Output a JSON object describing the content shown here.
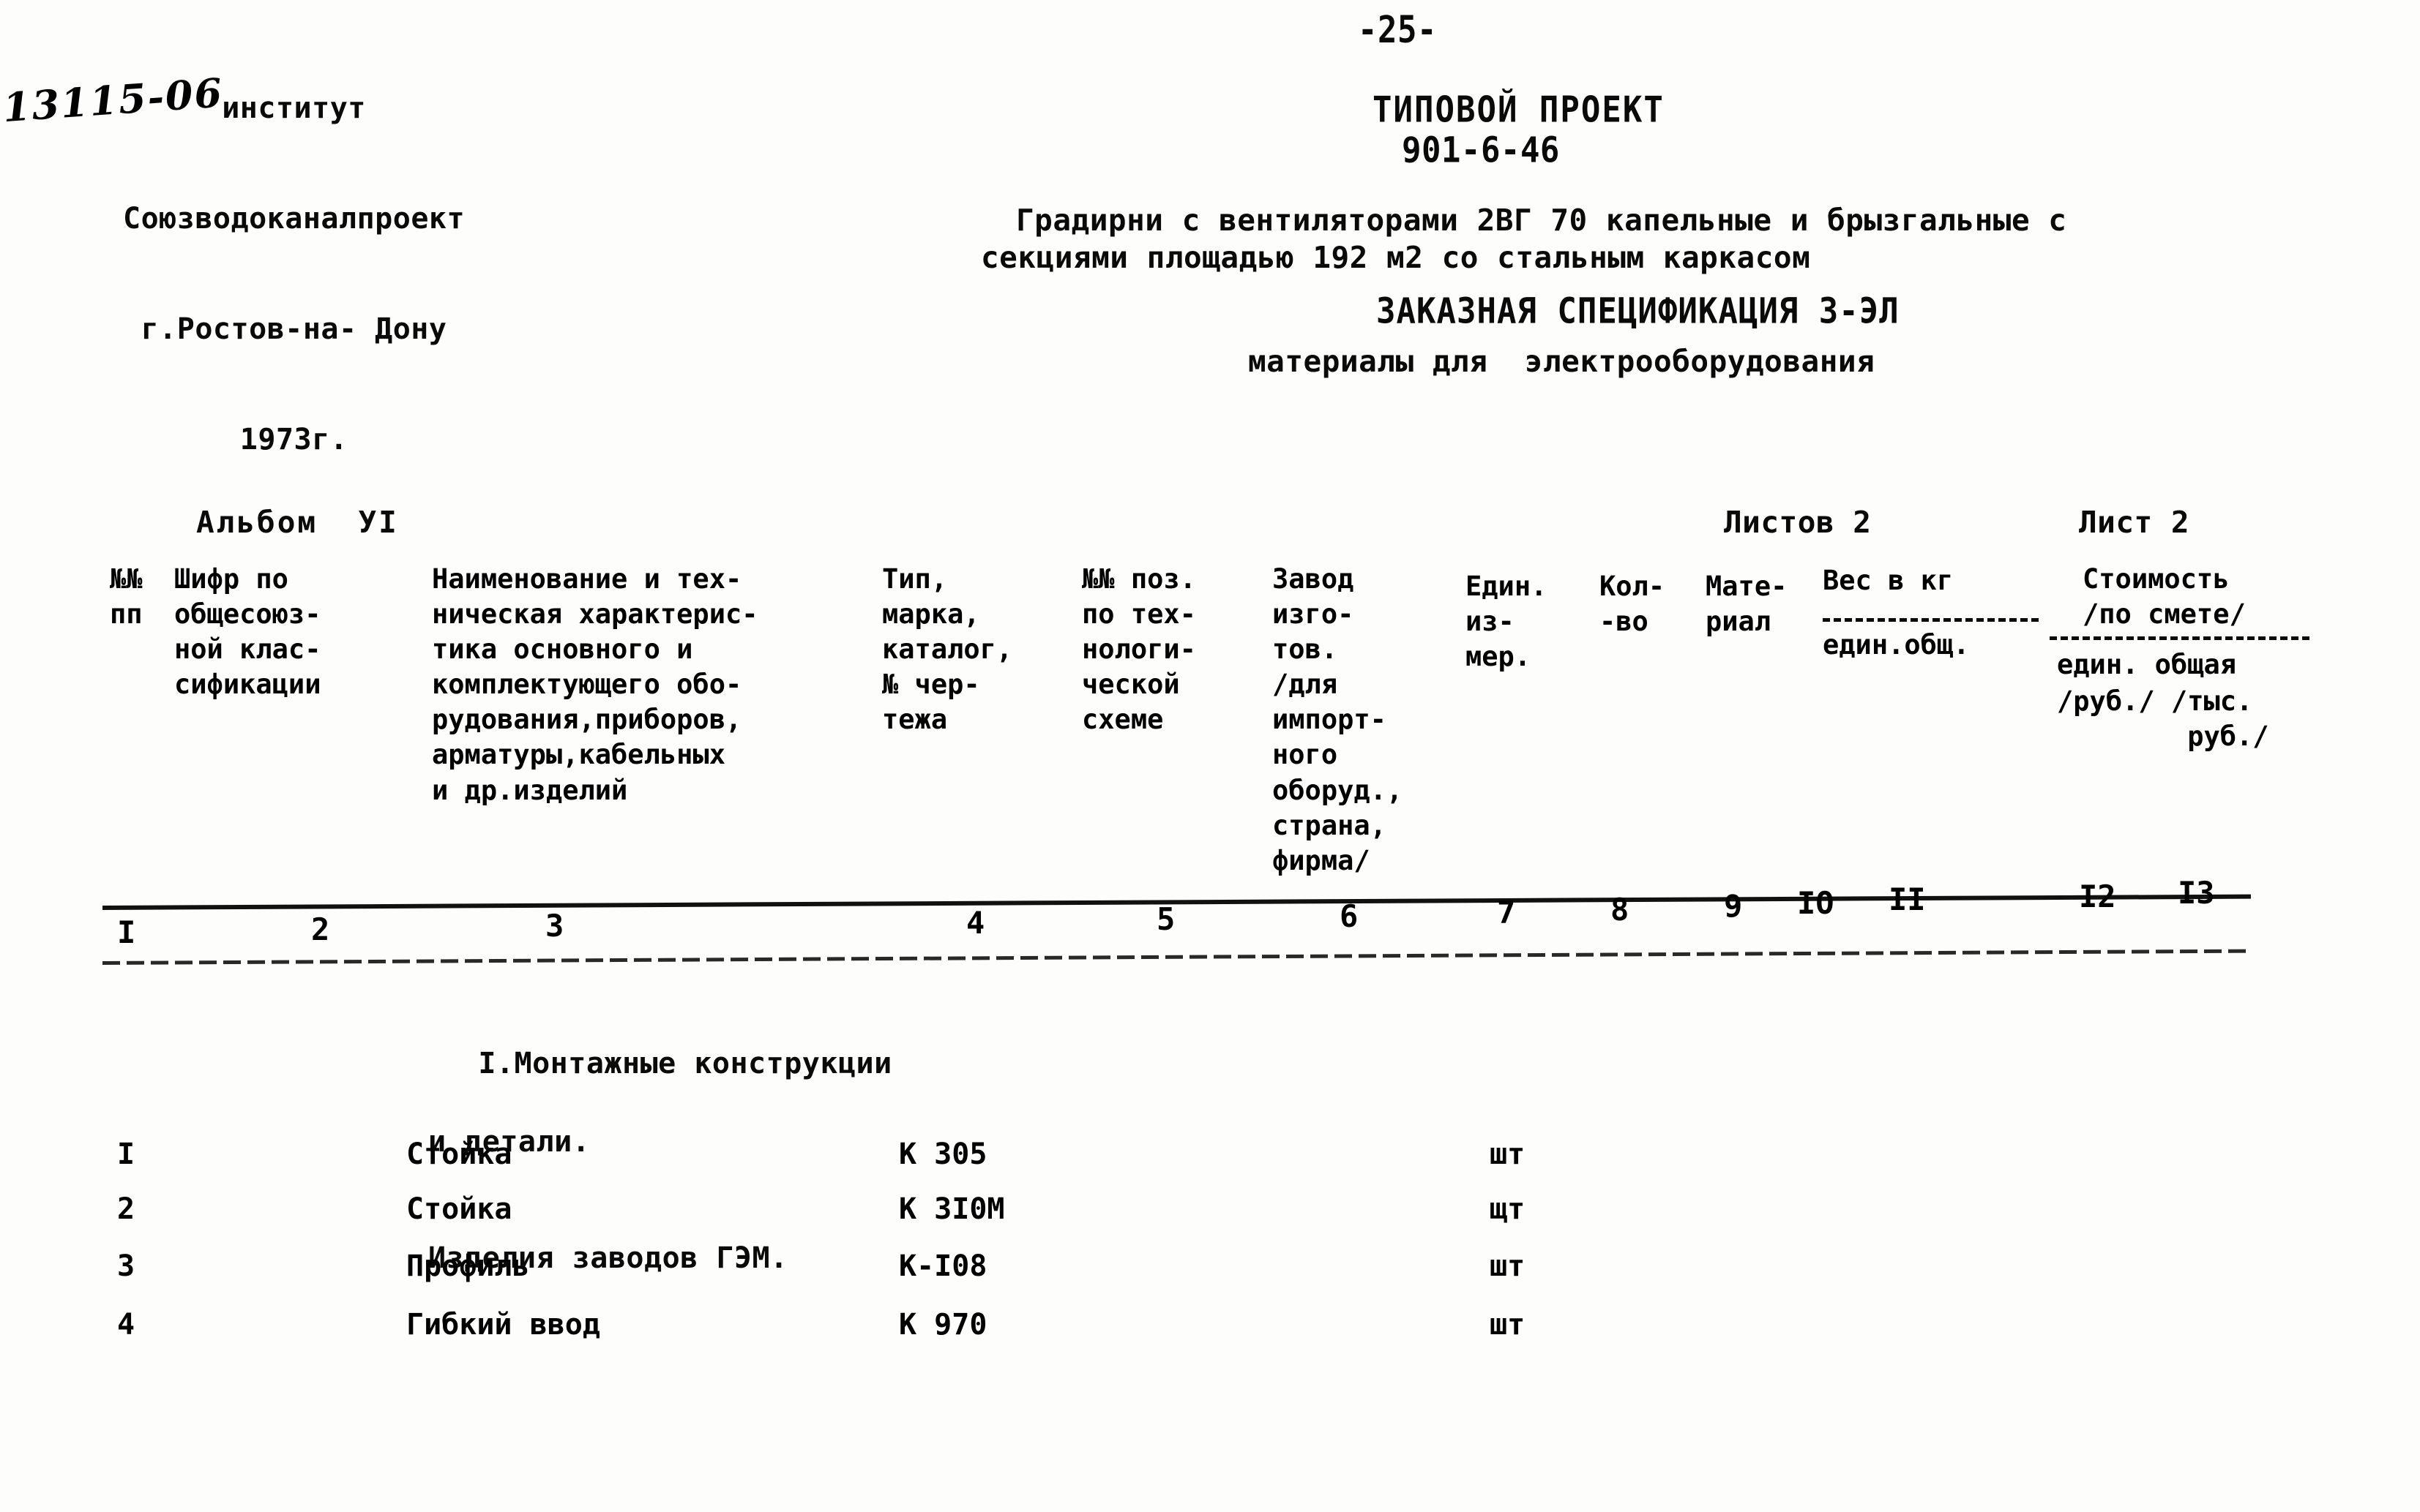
{
  "header": {
    "institute": [
      "институт",
      "Союзводоканалпроект",
      "г.Ростов-на- Дону",
      "1973г."
    ],
    "page_number": "-25-",
    "drawing_code": "13115-06"
  },
  "title": {
    "project_label": "ТИПОВОЙ ПРОЕКТ",
    "project_code": "901-6-46",
    "description_line1": "Градирни с вентиляторами 2ВГ 70 капельные и брызгальные с",
    "description_line2": "секциями площадью 192 м2 со стальным каркасом",
    "specification": "ЗАКАЗНАЯ СПЕЦИФИКАЦИЯ З-ЭЛ",
    "subtitle": "материалы для  электрооборудования"
  },
  "document_info": {
    "album": "Альбом  УI",
    "sheets_total": "Листов 2",
    "sheet_number": "Лист 2"
  },
  "table": {
    "headers": {
      "col1": "№№\nпп",
      "col2": "Шифр по\nобщесоюз-\nной клас-\nсификации",
      "col3": "Наименование и тех-\nническая характерис-\nтика основного и\nкомплектующего обо-\nрудования,приборов,\nарматуры,кабельных\nи др.изделий",
      "col4": "Тип,\nмарка,\nкаталог,\n№ чер-\nтежа",
      "col5": "№№ поз.\nпо тех-\nнологи-\nческой\nсхеме",
      "col6": "Завод\nизго-\nтов.\n/для\nимпорт-\nного\nоборуд.,\nстрана,\nфирма/",
      "col7": "Един.\nиз-\nмер.",
      "col8": "Кол-\n-во",
      "col9": "Мате-\nриал",
      "col10": "Вес в кг",
      "col10_sub": "един.общ.",
      "col13": "Стоимость\n/по смете/",
      "col13_sub1": "един. общая",
      "col13_sub2": "/руб./ /тыс.\n        руб./"
    },
    "column_numbers": [
      "I",
      "2",
      "3",
      "4",
      "5",
      "6",
      "7",
      "8",
      "9",
      "IO",
      "II",
      "I2",
      "I3"
    ],
    "column_number_x": [
      160,
      425,
      745,
      1320,
      1580,
      1830,
      2045,
      2200,
      2355,
      2455,
      2580,
      2840,
      2975
    ],
    "section_heading": {
      "line1": "I.Монтажные конструкции",
      "line2": "и детали.",
      "line3": "Изделия заводов ГЭМ."
    },
    "rows": [
      {
        "num": "I",
        "name": "Стойка",
        "type": "К 305",
        "unit": "шт"
      },
      {
        "num": "2",
        "name": "Стойка",
        "type": "К 3I0М",
        "unit": "щт"
      },
      {
        "num": "3",
        "name": "Профиль",
        "type": "К-I08",
        "unit": "шт"
      },
      {
        "num": "4",
        "name": "Гибкий ввод",
        "type": "К 970",
        "unit": "шт"
      }
    ],
    "row_y": [
      1555,
      1630,
      1708,
      1788
    ]
  },
  "colors": {
    "ink": "#0a0a0a",
    "paper": "#fdfdfb"
  }
}
